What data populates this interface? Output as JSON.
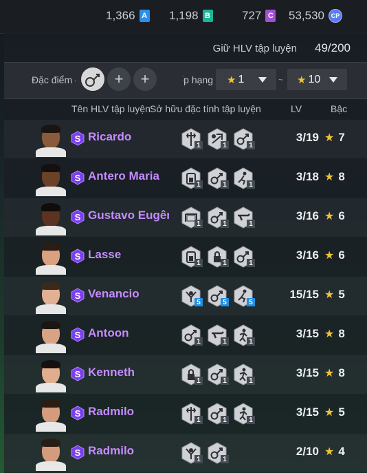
{
  "currencies": [
    {
      "value": "1,366",
      "icon": "a-badge-icon",
      "letter": "A",
      "color": "#2f8fe6"
    },
    {
      "value": "1,198",
      "icon": "b-badge-icon",
      "letter": "B",
      "color": "#1fb49a"
    },
    {
      "value": "727",
      "icon": "c-badge-icon",
      "letter": "C",
      "color": "#a34fd6"
    },
    {
      "value": "53,530",
      "icon": "cp-coin-icon",
      "letter": "CP",
      "color": "#5a7cf0"
    }
  ],
  "keep": {
    "label": "Giữ HLV tập luyện",
    "count": "49/200"
  },
  "filter": {
    "trait_label": "Đặc điểm c",
    "rank_label": "ếp hạng",
    "min": {
      "value": "1"
    },
    "max": {
      "value": "10"
    },
    "tilde": "~"
  },
  "headers": {
    "name": "Tên HLV tập luyện",
    "traits": "Sở hữu đặc tính tập luyện",
    "lv": "LV",
    "grade": "Bậc"
  },
  "rows": [
    {
      "name": "Ricardo",
      "traits": [
        {
          "icon": "crossroad-icon",
          "n": "1",
          "blue": false
        },
        {
          "icon": "tackle-icon",
          "n": "1",
          "blue": false
        },
        {
          "icon": "dribble-icon",
          "n": "1",
          "blue": false
        }
      ],
      "lv": "3/19",
      "grade": "7",
      "skin": "#8a5a3c",
      "hair": "#1b1410"
    },
    {
      "name": "Antero Maria",
      "traits": [
        {
          "icon": "stamina-icon",
          "n": "1",
          "blue": false
        },
        {
          "icon": "dribble-icon",
          "n": "1",
          "blue": false
        },
        {
          "icon": "run-icon",
          "n": "1",
          "blue": false
        }
      ],
      "lv": "3/18",
      "grade": "8",
      "skin": "#6b4228",
      "hair": "#141010"
    },
    {
      "name": "Gustavo Eugênic",
      "traits": [
        {
          "icon": "goal-icon",
          "n": "1",
          "blue": false
        },
        {
          "icon": "dribble-icon",
          "n": "1",
          "blue": false
        },
        {
          "icon": "shoot-icon",
          "n": "1",
          "blue": false
        }
      ],
      "lv": "3/16",
      "grade": "6",
      "skin": "#5a3420",
      "hair": "#0f0c0a"
    },
    {
      "name": "Lasse",
      "traits": [
        {
          "icon": "stamina-icon",
          "n": "1",
          "blue": false
        },
        {
          "icon": "lock-icon",
          "n": "1",
          "blue": false
        },
        {
          "icon": "dribble-icon",
          "n": "1",
          "blue": false
        }
      ],
      "lv": "3/16",
      "grade": "6",
      "skin": "#d9a17f",
      "hair": "#2a1d14"
    },
    {
      "name": "Venancio",
      "traits": [
        {
          "icon": "heading-icon",
          "n": "5",
          "blue": true
        },
        {
          "icon": "dribble-icon",
          "n": "5",
          "blue": true
        },
        {
          "icon": "run-icon",
          "n": "5",
          "blue": true
        }
      ],
      "lv": "15/15",
      "grade": "5",
      "skin": "#e2b092",
      "hair": "#3a2a1e"
    },
    {
      "name": "Antoon",
      "traits": [
        {
          "icon": "dribble-icon",
          "n": "1",
          "blue": false
        },
        {
          "icon": "shoot-icon",
          "n": "1",
          "blue": false
        },
        {
          "icon": "sprint-icon",
          "n": "1",
          "blue": false
        }
      ],
      "lv": "3/15",
      "grade": "8",
      "skin": "#d8a385",
      "hair": "#1c1612"
    },
    {
      "name": "Kenneth",
      "traits": [
        {
          "icon": "lock-icon",
          "n": "1",
          "blue": false
        },
        {
          "icon": "dribble-icon",
          "n": "1",
          "blue": false
        },
        {
          "icon": "sprint-icon",
          "n": "1",
          "blue": false
        }
      ],
      "lv": "3/15",
      "grade": "8",
      "skin": "#e0ae8c",
      "hair": "#16110e"
    },
    {
      "name": "Radmilo",
      "traits": [
        {
          "icon": "crossroad-icon",
          "n": "1",
          "blue": false
        },
        {
          "icon": "dribble-icon",
          "n": "1",
          "blue": false
        },
        {
          "icon": "sprint-icon",
          "n": "1",
          "blue": false
        }
      ],
      "lv": "3/15",
      "grade": "5",
      "skin": "#d49c7c",
      "hair": "#2a1d14"
    },
    {
      "name": "Radmilo",
      "traits": [
        {
          "icon": "heading-icon",
          "n": "1",
          "blue": false
        },
        {
          "icon": "dribble-icon",
          "n": "1",
          "blue": false
        }
      ],
      "lv": "2/10",
      "grade": "4",
      "skin": "#d49c7c",
      "hair": "#2a1d14"
    }
  ]
}
